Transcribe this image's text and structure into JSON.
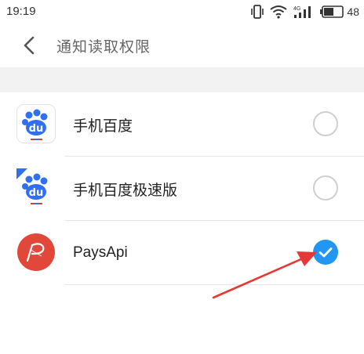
{
  "status_bar": {
    "time": "19:19",
    "battery": "48",
    "icons": [
      "vibrate-icon",
      "wifi-icon",
      "signal-4g-icon",
      "battery-icon"
    ]
  },
  "header": {
    "back_icon": "chevron-left-icon",
    "title": "通知读取权限"
  },
  "apps": [
    {
      "name": "手机百度",
      "icon": "baidu-app-icon",
      "checked": false
    },
    {
      "name": "手机百度极速版",
      "icon": "baidu-lite-app-icon",
      "checked": false
    },
    {
      "name": "PaysApi",
      "icon": "paysapi-app-icon",
      "checked": true
    }
  ],
  "colors": {
    "accent": "#2196f3",
    "annotation_arrow": "#e53935",
    "baidu_blue": "#2f6ff0",
    "paysapi_red": "#e2483a"
  }
}
